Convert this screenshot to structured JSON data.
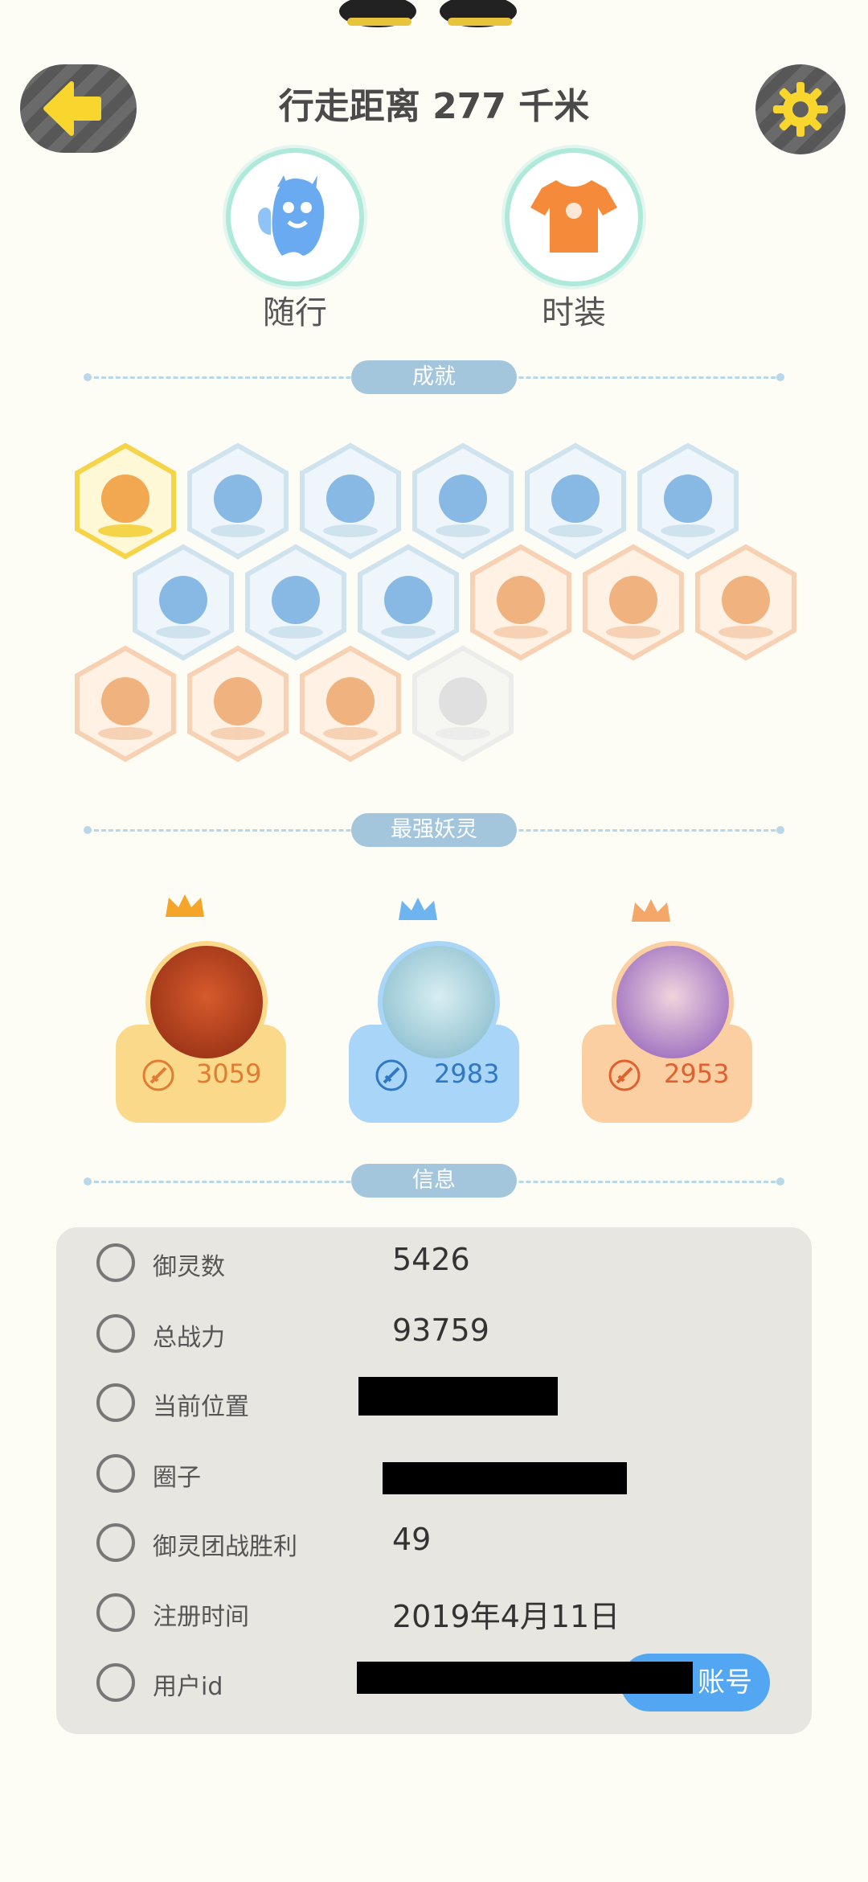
{
  "header": {
    "title": "行走距离 277 千米"
  },
  "quick_buttons": [
    {
      "label": "随行",
      "icon": "ghost-pet-icon"
    },
    {
      "label": "时装",
      "icon": "tshirt-icon"
    }
  ],
  "sections": {
    "achievements": "成就",
    "strongest": "最强妖灵",
    "info": "信息"
  },
  "achievements": {
    "badges": [
      {
        "icon": "fox-face-badge-icon",
        "state": "gold"
      },
      {
        "icon": "sneaker-badge-icon",
        "state": "blue"
      },
      {
        "icon": "portal-badge-icon",
        "state": "blue"
      },
      {
        "icon": "moon-badge-icon",
        "state": "blue"
      },
      {
        "icon": "crystal-ball-badge-icon",
        "state": "blue"
      },
      {
        "icon": "yin-yang-wave-badge-icon",
        "state": "blue"
      },
      {
        "icon": "spirit-figure-badge-icon",
        "state": "blue"
      },
      {
        "icon": "yin-yang-board-badge-icon",
        "state": "blue"
      },
      {
        "icon": "scroll-badge-icon",
        "state": "blue"
      },
      {
        "icon": "crystal-egg-badge-icon",
        "state": "orange"
      },
      {
        "icon": "cart-cat-badge-icon",
        "state": "orange"
      },
      {
        "icon": "cat-balloon-badge-icon",
        "state": "orange"
      },
      {
        "icon": "cat-statue-badge-icon",
        "state": "orange"
      },
      {
        "icon": "cat-pair-badge-icon",
        "state": "orange"
      },
      {
        "icon": "open-book-badge-icon",
        "state": "orange"
      },
      {
        "icon": "locked-badge-icon",
        "state": "locked"
      }
    ]
  },
  "strongest_spirits": [
    {
      "score": "3059",
      "color": "#fbd98a",
      "crown": "gold"
    },
    {
      "score": "2983",
      "color": "#a9d6f8",
      "crown": "blue"
    },
    {
      "score": "2953",
      "color": "#fbcfa2",
      "crown": "orange"
    }
  ],
  "info": {
    "rows": [
      {
        "icon": "spirit-count-icon",
        "label": "御灵数",
        "value": "5426"
      },
      {
        "icon": "combat-power-icon",
        "label": "总战力",
        "value": "93759"
      },
      {
        "icon": "location-pin-icon",
        "label": "当前位置",
        "value": ""
      },
      {
        "icon": "circle-group-icon",
        "label": "圈子",
        "value": ""
      },
      {
        "icon": "team-battle-icon",
        "label": "御灵团战胜利",
        "value": "49"
      },
      {
        "icon": "clock-icon",
        "label": "注册时间",
        "value": "2019年4月11日"
      },
      {
        "icon": "user-id-icon",
        "label": "用户id",
        "value": ""
      }
    ],
    "account_button": "账号"
  }
}
